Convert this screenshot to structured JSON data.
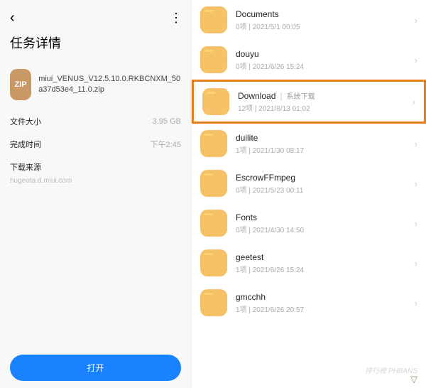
{
  "left": {
    "title": "任务详情",
    "zip_badge": "ZIP",
    "filename": "miui_VENUS_V12.5.10.0.RKBCNXM_50a37d53e4_11.0.zip",
    "size_label": "文件大小",
    "size_value": "3.95 GB",
    "time_label": "完成时间",
    "time_value": "下午2:45",
    "source_label": "下载来源",
    "source_value": "hugeota.d.miui.com",
    "open_button": "打开"
  },
  "folders": [
    {
      "name": "Documents",
      "count": "0项",
      "date": "2021/5/1 00:05",
      "tag": "",
      "hl": false
    },
    {
      "name": "douyu",
      "count": "0项",
      "date": "2021/6/26 15:24",
      "tag": "",
      "hl": false
    },
    {
      "name": "Download",
      "count": "12项",
      "date": "2021/8/13 01:02",
      "tag": "系统下载",
      "hl": true
    },
    {
      "name": "duilite",
      "count": "1项",
      "date": "2021/1/30 08:17",
      "tag": "",
      "hl": false
    },
    {
      "name": "EscrowFFmpeg",
      "count": "0项",
      "date": "2021/5/23 00:11",
      "tag": "",
      "hl": false
    },
    {
      "name": "Fonts",
      "count": "0项",
      "date": "2021/4/30 14:50",
      "tag": "",
      "hl": false
    },
    {
      "name": "geetest",
      "count": "1项",
      "date": "2021/6/26 15:24",
      "tag": "",
      "hl": false
    },
    {
      "name": "gmcchh",
      "count": "1项",
      "date": "2021/6/26 20:57",
      "tag": "",
      "hl": false
    }
  ],
  "watermark": "排行榜\nPHBANS"
}
